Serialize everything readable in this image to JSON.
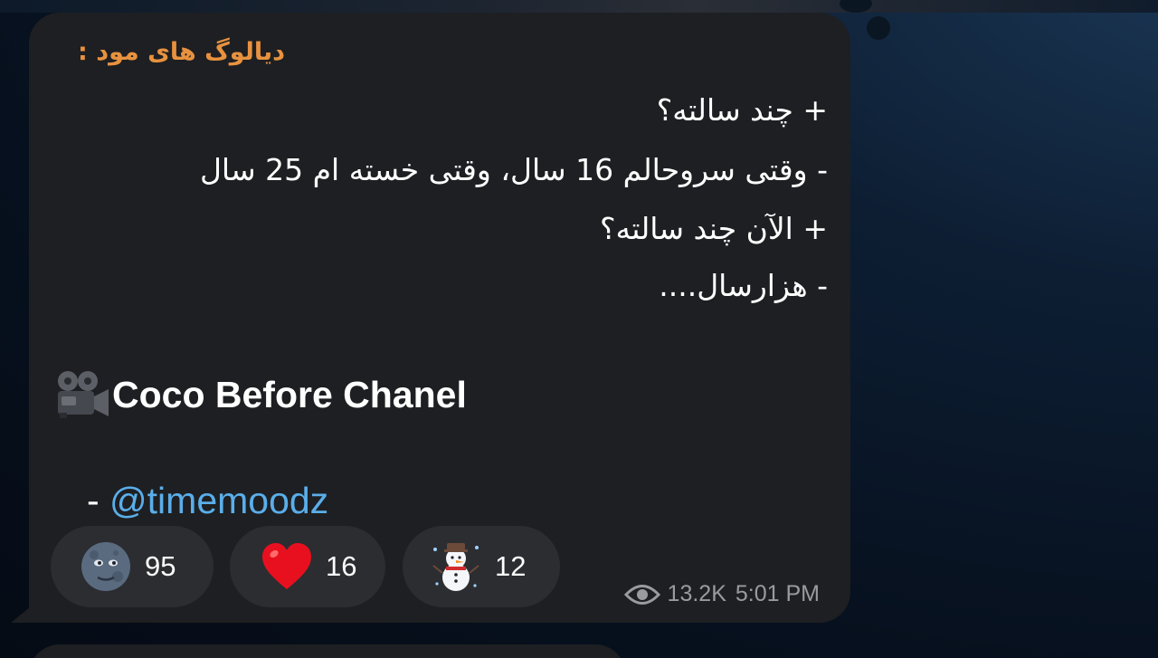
{
  "message": {
    "sender": "دیالوگ های مود :",
    "lines": [
      "+ چند سالته؟",
      "- وقتی سروحالم 16 سال، وقتی خسته ام 25 سال",
      "+ الآن چند سالته؟",
      "- هزارسال...."
    ],
    "movie_title": "Coco Before Chanel",
    "credit_prefix": "- ",
    "credit_handle": "@timemoodz",
    "views": "13.2K",
    "time": "5:01 PM"
  },
  "reactions": [
    {
      "emoji": "new-moon-face",
      "count": "95"
    },
    {
      "emoji": "red-heart",
      "count": "16"
    },
    {
      "emoji": "snowman",
      "count": "12"
    }
  ],
  "colors": {
    "bubble": "#1e1f22",
    "sender": "#e8923f",
    "link": "#5aaeea",
    "reaction_bg": "#2c2d31",
    "meta": "#9a9b9f"
  }
}
